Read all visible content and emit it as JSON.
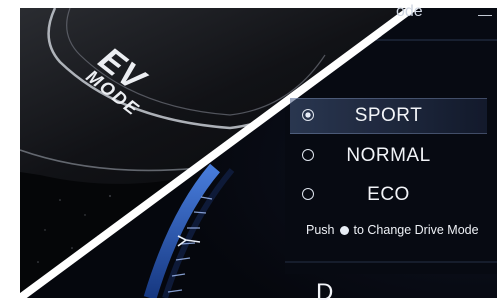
{
  "button": {
    "ev_label": "EV",
    "mode_label": "MODE"
  },
  "display": {
    "header_fragment": "ode",
    "header_dash": "—",
    "options": [
      {
        "label": "SPORT",
        "selected": true
      },
      {
        "label": "NORMAL",
        "selected": false
      },
      {
        "label": "ECO",
        "selected": false
      }
    ],
    "hint_prefix": "Push",
    "hint_suffix": "to Change Drive Mode",
    "gear": "D"
  },
  "colors": {
    "display_background": "#05070d",
    "selected_highlight": "#46597f",
    "gauge_blue": "#2f64c8",
    "button_surface": "#0c0d10",
    "white_border": "#ffffff"
  }
}
